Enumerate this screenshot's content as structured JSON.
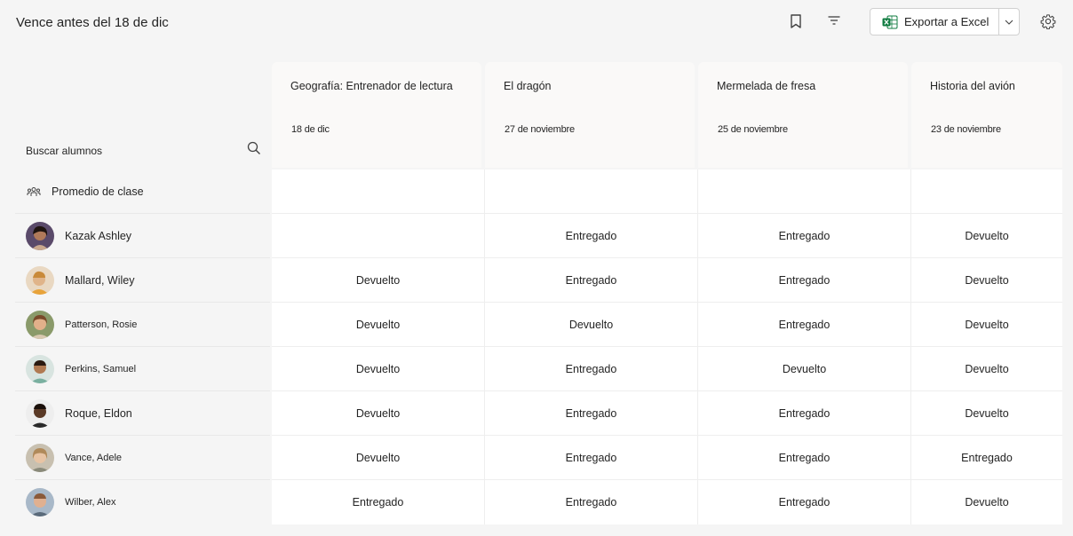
{
  "header": {
    "title": "Vence antes del 18 de dic",
    "export_label": "Exportar a Excel",
    "icons": [
      "bookmark-icon",
      "filter-icon",
      "excel-icon",
      "chevron-down-icon",
      "gear-icon"
    ]
  },
  "search": {
    "label": "Buscar alumnos"
  },
  "assignments": [
    {
      "title": "Geografía: Entrenador de lectura",
      "due": "18 de dic"
    },
    {
      "title": "El dragón",
      "due": "27 de noviembre"
    },
    {
      "title": "Mermelada de fresa",
      "due": "25 de noviembre"
    },
    {
      "title": "Historia del avión",
      "due": "23 de noviembre"
    }
  ],
  "class_average": {
    "label": "Promedio de clase"
  },
  "students": [
    {
      "name": "Kazak Ashley",
      "statuses": [
        "",
        "Entregado",
        "Entregado",
        "Devuelto"
      ]
    },
    {
      "name": "Mallard, Wiley",
      "statuses": [
        "Devuelto",
        "Entregado",
        "Entregado",
        "Devuelto"
      ]
    },
    {
      "name": "Patterson, Rosie",
      "statuses": [
        "Devuelto",
        "Devuelto",
        "Entregado",
        "Devuelto"
      ]
    },
    {
      "name": "Perkins, Samuel",
      "statuses": [
        "Devuelto",
        "Entregado",
        "Devuelto",
        "Devuelto"
      ]
    },
    {
      "name": "Roque, Eldon",
      "statuses": [
        "Devuelto",
        "Entregado",
        "Entregado",
        "Devuelto"
      ]
    },
    {
      "name": "Vance, Adele",
      "statuses": [
        "Devuelto",
        "Entregado",
        "Entregado",
        "Entregado"
      ]
    },
    {
      "name": "Wilber, Alex",
      "statuses": [
        "Entregado",
        "Entregado",
        "Entregado",
        "Devuelto"
      ]
    }
  ]
}
